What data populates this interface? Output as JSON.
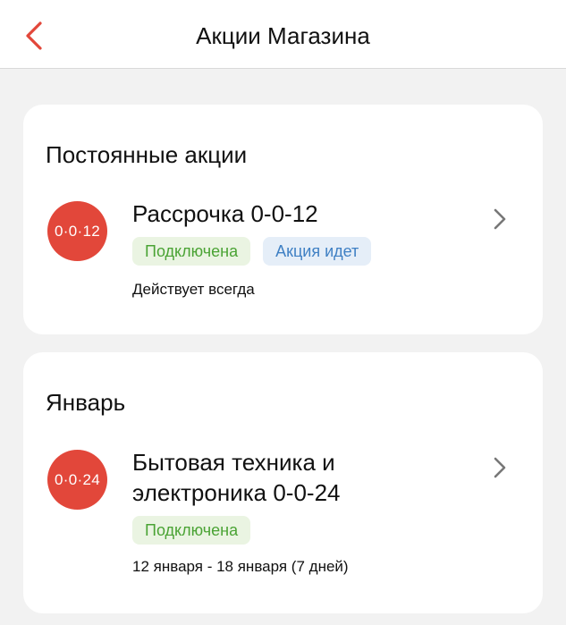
{
  "header": {
    "title": "Акции Магазина",
    "back_icon": "chevron-left-icon"
  },
  "sections": [
    {
      "title": "Постоянные акции",
      "promo": {
        "badge": "0·0·12",
        "title": "Рассрочка 0-0-12",
        "tags": [
          "Подключена",
          "Акция идет"
        ],
        "date": "Действует всегда"
      }
    },
    {
      "title": "Январь",
      "promo": {
        "badge": "0·0·24",
        "title": "Бытовая техника и электроника 0-0-24",
        "tags": [
          "Подключена"
        ],
        "date": "12 января - 18 января (7 дней)"
      }
    }
  ],
  "colors": {
    "accent": "#e2473a",
    "tag_green_bg": "#eaf4e2",
    "tag_green_text": "#4aa334",
    "tag_blue_bg": "#e5eef8",
    "tag_blue_text": "#3f80c4",
    "background": "#f2f2f2"
  }
}
